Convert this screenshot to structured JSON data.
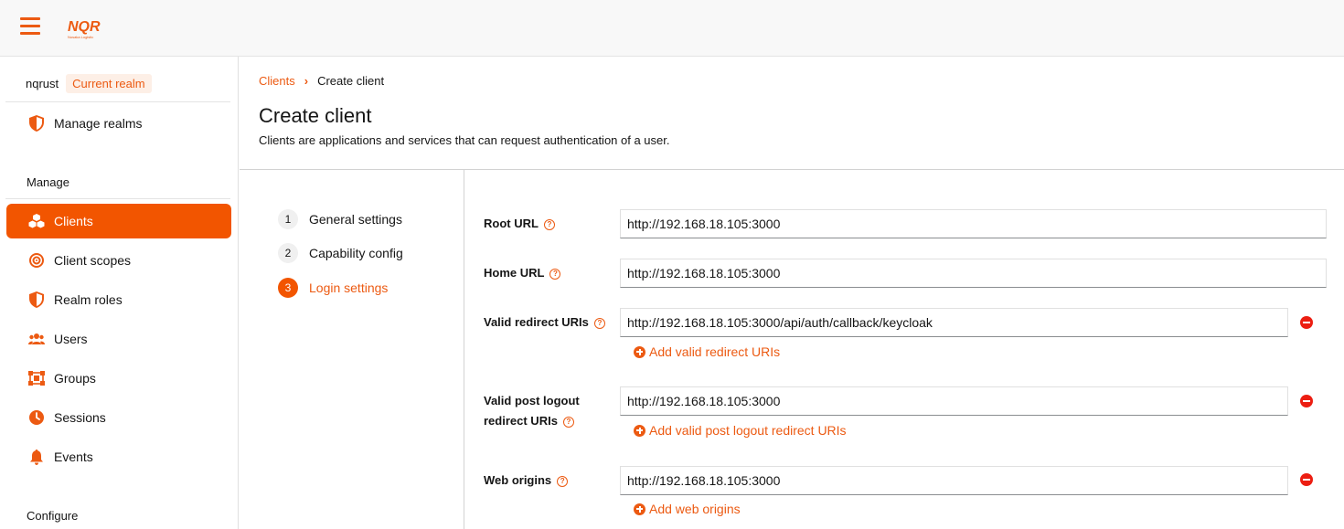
{
  "topbar": {
    "logo_text": "NQR",
    "logo_tagline": "Nusaka Logistic"
  },
  "sidebar": {
    "realm_name": "nqrust",
    "realm_badge": "Current realm",
    "manage_realms": "Manage realms",
    "section_manage": "Manage",
    "section_configure": "Configure",
    "items": [
      {
        "label": "Clients",
        "icon": "clients-icon",
        "active": true
      },
      {
        "label": "Client scopes",
        "icon": "target-icon"
      },
      {
        "label": "Realm roles",
        "icon": "shield-icon"
      },
      {
        "label": "Users",
        "icon": "users-icon"
      },
      {
        "label": "Groups",
        "icon": "groups-icon"
      },
      {
        "label": "Sessions",
        "icon": "clock-icon"
      },
      {
        "label": "Events",
        "icon": "bell-icon"
      }
    ]
  },
  "header": {
    "breadcrumb": [
      "Clients",
      "Create client"
    ],
    "title": "Create client",
    "description": "Clients are applications and services that can request authentication of a user."
  },
  "wizard": {
    "steps": [
      {
        "num": "1",
        "label": "General settings"
      },
      {
        "num": "2",
        "label": "Capability config"
      },
      {
        "num": "3",
        "label": "Login settings",
        "current": true
      }
    ]
  },
  "form": {
    "root_url": {
      "label": "Root URL",
      "value": "http://192.168.18.105:3000"
    },
    "home_url": {
      "label": "Home URL",
      "value": "http://192.168.18.105:3000"
    },
    "redirect_uris": {
      "label": "Valid redirect URIs",
      "value": "http://192.168.18.105:3000/api/auth/callback/keycloak",
      "add": "Add valid redirect URIs"
    },
    "post_logout": {
      "label_line1": "Valid post logout",
      "label_line2": "redirect URIs",
      "value": "http://192.168.18.105:3000",
      "add": "Add valid post logout redirect URIs"
    },
    "web_origins": {
      "label": "Web origins",
      "value": "http://192.168.18.105:3000",
      "add": "Add web origins"
    }
  },
  "colors": {
    "accent": "#ec5a12",
    "active_bg": "#f25500",
    "remove": "#ec1e12"
  }
}
